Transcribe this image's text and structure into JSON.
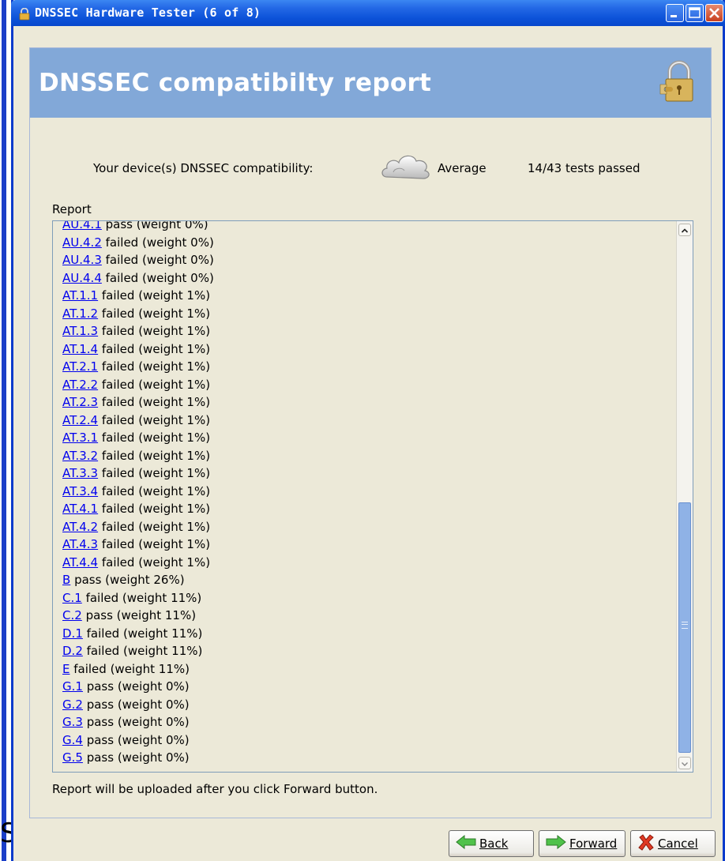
{
  "window": {
    "title": "DNSSEC Hardware Tester (6 of 8)"
  },
  "header": {
    "title": "DNSSEC compatibilty report"
  },
  "summary": {
    "compat_label": "Your device(s) DNSSEC compatibility:",
    "rating": "Average",
    "tests_passed": "14/43 tests passed"
  },
  "report": {
    "label": "Report",
    "items": [
      {
        "code": "AU.4.1",
        "text": " pass (weight 0%)"
      },
      {
        "code": "AU.4.2",
        "text": " failed (weight 0%)"
      },
      {
        "code": "AU.4.3",
        "text": " failed (weight 0%)"
      },
      {
        "code": "AU.4.4",
        "text": " failed (weight 0%)"
      },
      {
        "code": "AT.1.1",
        "text": " failed (weight 1%)"
      },
      {
        "code": "AT.1.2",
        "text": " failed (weight 1%)"
      },
      {
        "code": "AT.1.3",
        "text": " failed (weight 1%)"
      },
      {
        "code": "AT.1.4",
        "text": " failed (weight 1%)"
      },
      {
        "code": "AT.2.1",
        "text": " failed (weight 1%)"
      },
      {
        "code": "AT.2.2",
        "text": " failed (weight 1%)"
      },
      {
        "code": "AT.2.3",
        "text": " failed (weight 1%)"
      },
      {
        "code": "AT.2.4",
        "text": " failed (weight 1%)"
      },
      {
        "code": "AT.3.1",
        "text": " failed (weight 1%)"
      },
      {
        "code": "AT.3.2",
        "text": " failed (weight 1%)"
      },
      {
        "code": "AT.3.3",
        "text": " failed (weight 1%)"
      },
      {
        "code": "AT.3.4",
        "text": " failed (weight 1%)"
      },
      {
        "code": "AT.4.1",
        "text": " failed (weight 1%)"
      },
      {
        "code": "AT.4.2",
        "text": " failed (weight 1%)"
      },
      {
        "code": "AT.4.3",
        "text": " failed (weight 1%)"
      },
      {
        "code": "AT.4.4",
        "text": " failed (weight 1%)"
      },
      {
        "code": "B",
        "text": " pass (weight 26%)"
      },
      {
        "code": "C.1",
        "text": " failed (weight 11%)"
      },
      {
        "code": "C.2",
        "text": " pass (weight 11%)"
      },
      {
        "code": "D.1",
        "text": " failed (weight 11%)"
      },
      {
        "code": "D.2",
        "text": " failed (weight 11%)"
      },
      {
        "code": "E",
        "text": " failed (weight 11%)"
      },
      {
        "code": "G.1",
        "text": " pass (weight 0%)"
      },
      {
        "code": "G.2",
        "text": " pass (weight 0%)"
      },
      {
        "code": "G.3",
        "text": " pass (weight 0%)"
      },
      {
        "code": "G.4",
        "text": " pass (weight 0%)"
      },
      {
        "code": "G.5",
        "text": " pass (weight 0%)"
      }
    ]
  },
  "upload_note": "Report will be uploaded after you click Forward button.",
  "buttons": {
    "back": "Back",
    "forward": "Forward",
    "cancel": "Cancel"
  },
  "background_glyph": "S",
  "colors": {
    "title_bar": "#0c52d8",
    "header_band": "#82a8d8",
    "link": "#0000ee",
    "scroll_thumb": "#8fb2e6"
  },
  "icons": {
    "title": "padlock-icon",
    "header": "padlock-puzzle-icon",
    "rating": "cloud-icon",
    "back": "green-left-arrow-icon",
    "forward": "green-right-arrow-icon",
    "cancel": "red-x-icon"
  }
}
